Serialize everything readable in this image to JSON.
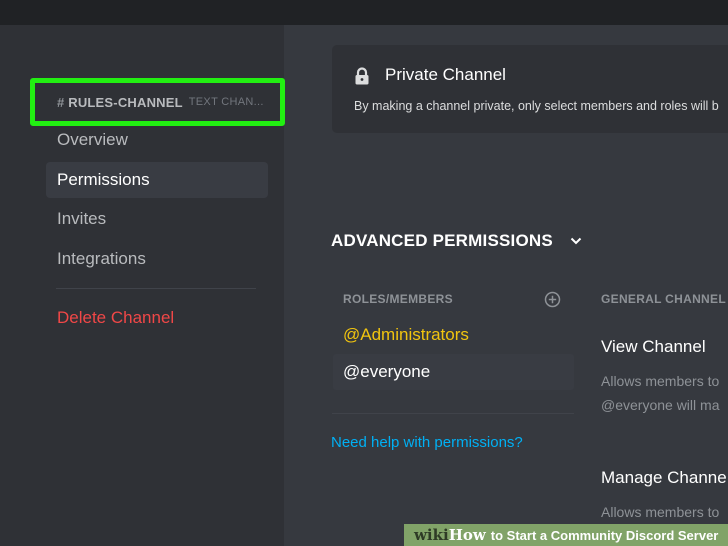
{
  "sidebar": {
    "channel_header": {
      "hash": "#",
      "name": "RULES-CHANNEL",
      "type": "TEXT CHAN..."
    },
    "items": [
      {
        "label": "Overview"
      },
      {
        "label": "Permissions"
      },
      {
        "label": "Invites"
      },
      {
        "label": "Integrations"
      }
    ],
    "delete_label": "Delete Channel"
  },
  "private_channel": {
    "title": "Private Channel",
    "description": "By making a channel private, only select members and roles will b",
    "icon": "lock-icon"
  },
  "advanced": {
    "title": "ADVANCED PERMISSIONS",
    "roles_header": "ROLES/MEMBERS",
    "roles": [
      {
        "label": "@Administrators",
        "color": "#f1c40f"
      },
      {
        "label": "@everyone"
      }
    ],
    "help_link": "Need help with permissions?"
  },
  "general": {
    "header": "GENERAL CHANNEL",
    "permissions": [
      {
        "title": "View Channel",
        "desc_lines": [
          "Allows members to",
          "@everyone will ma"
        ]
      },
      {
        "title": "Manage Channe",
        "desc_lines": [
          "Allows members to"
        ]
      }
    ]
  },
  "watermark": {
    "wiki": "wiki",
    "how": "How",
    "rest": "to Start a Community Discord Server"
  },
  "colors": {
    "highlight_box": "#22ef12",
    "danger": "#f04747",
    "link": "#00b0f4",
    "admin_role": "#f1c40f"
  }
}
